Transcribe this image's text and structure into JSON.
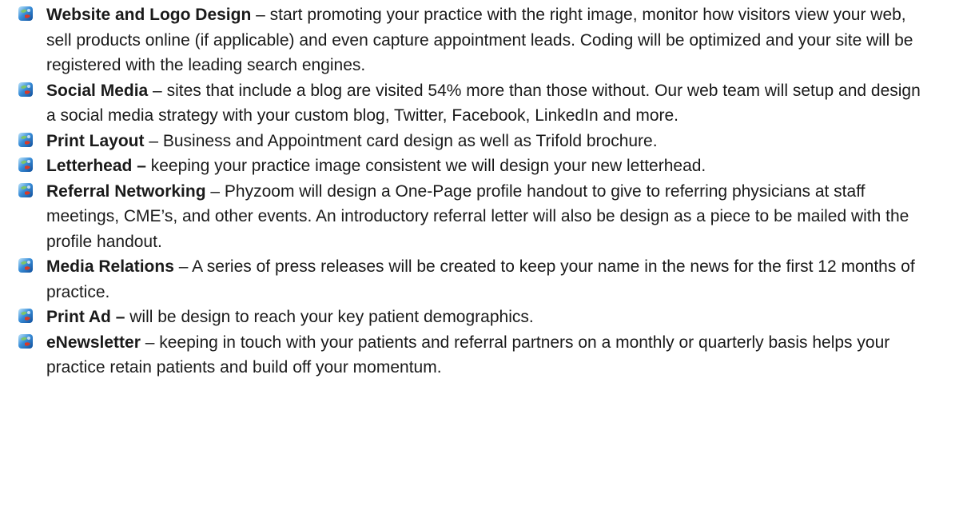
{
  "items": [
    {
      "icon": "globe-bullet-icon",
      "term": "Website and Logo Design",
      "sep": " – ",
      "text": "start promoting your practice with the right image, monitor how visitors view your web, sell products online (if applicable) and even capture appointment leads. Coding will be optimized and your site will be registered with the leading search engines."
    },
    {
      "icon": "globe-bullet-icon",
      "term": "Social Media",
      "sep": " – ",
      "text": "sites that include a blog are visited 54% more than those without. Our web team will setup and design a social media strategy with your custom blog, Twitter, Facebook, LinkedIn and more."
    },
    {
      "icon": "globe-bullet-icon",
      "term": "Print Layout",
      "sep": " – ",
      "text": "Business and Appointment card design as well as Trifold brochure."
    },
    {
      "icon": "globe-bullet-icon",
      "term": "Letterhead –",
      "sep": " ",
      "text": "keeping your practice image consistent we will design your new letterhead."
    },
    {
      "icon": "globe-bullet-icon",
      "term": "Referral Networking",
      "sep": " – ",
      "text": "Phyzoom will design a One-Page profile handout to give to referring physicians at staff meetings, CME’s, and other events.  An introductory referral letter will also be design as a piece to be mailed with the profile handout."
    },
    {
      "icon": "globe-bullet-icon",
      "term": "Media Relations",
      "sep": " – ",
      "text": "A series of press releases will be created to keep your name in the news for the first 12 months of practice."
    },
    {
      "icon": "globe-bullet-icon",
      "term": "Print Ad –",
      "sep": " ",
      "text": "will be design to reach your key patient demographics."
    },
    {
      "icon": "globe-bullet-icon",
      "term": "eNewsletter",
      "sep": " – ",
      "text": "keeping in touch with your patients and referral partners on a monthly or quarterly basis helps your practice retain patients and build off your momentum."
    }
  ],
  "colors": {
    "text": "#1a1a1a",
    "bullet_blue": "#1e73c8",
    "bullet_light": "#8fd0f5",
    "bullet_red": "#d63a2a"
  }
}
